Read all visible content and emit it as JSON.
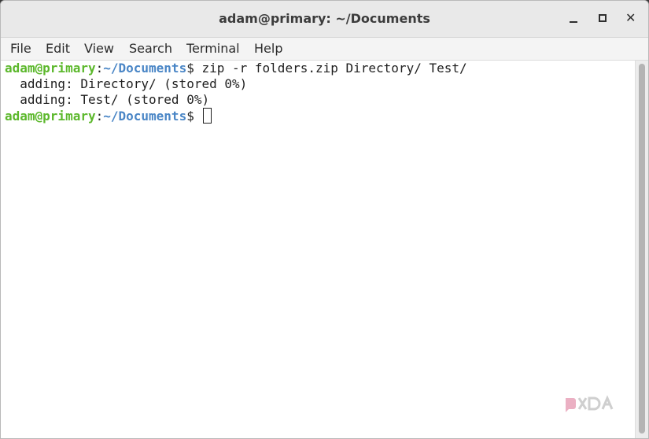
{
  "window": {
    "title": "adam@primary: ~/Documents",
    "controls": [
      "minimize-icon",
      "maximize-icon",
      "close-icon"
    ],
    "close_glyph": "✕"
  },
  "menu": {
    "items": [
      "File",
      "Edit",
      "View",
      "Search",
      "Terminal",
      "Help"
    ]
  },
  "terminal": {
    "prompt_user": "adam@primary",
    "prompt_sep": ":",
    "prompt_path": "~/Documents",
    "prompt_symbol": "$",
    "command": " zip -r folders.zip Directory/ Test/",
    "output": [
      "  adding: Directory/ (stored 0%)",
      "  adding: Test/ (stored 0%)"
    ]
  },
  "watermark": {
    "brand": "XDA",
    "icon": "xda-logo-icon"
  },
  "colors": {
    "prompt_user": "#5cb82c",
    "prompt_path": "#4a86c6",
    "text": "#1f1f1f"
  }
}
